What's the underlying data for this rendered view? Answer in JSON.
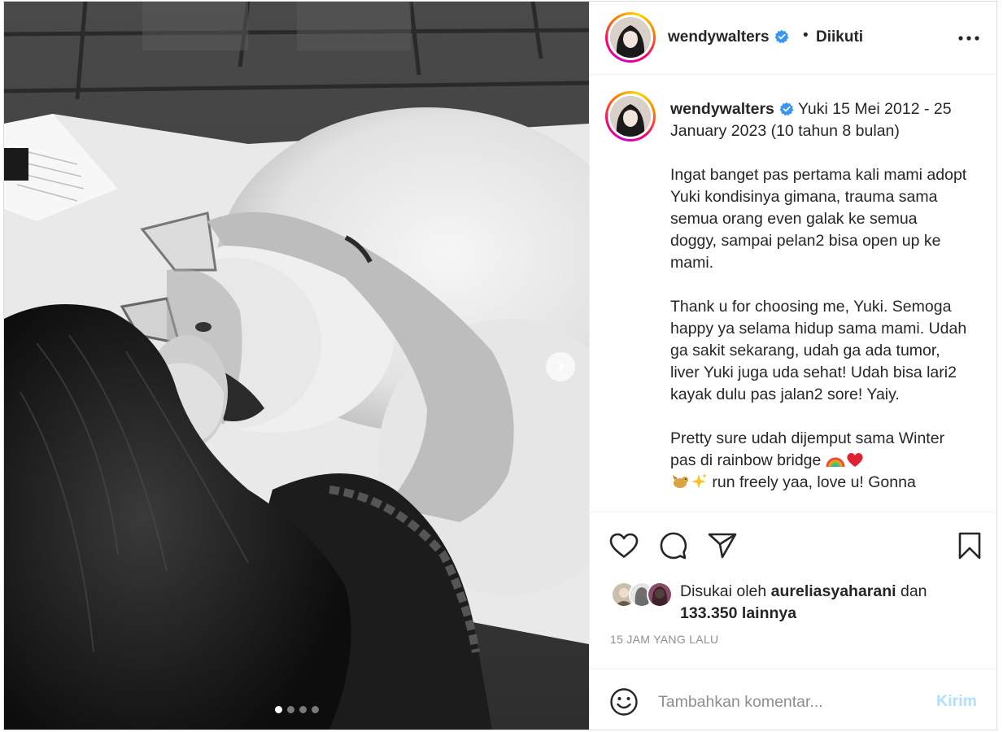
{
  "header": {
    "username": "wendywalters",
    "verified": true,
    "separator": "•",
    "follow_status": "Diikuti",
    "more_icon": "more-horizontal-icon"
  },
  "caption": {
    "username": "wendywalters",
    "text_part1": " Yuki 15 Mei 2012 - 25 January 2023 (10 tahun 8 bulan)\n\nIngat banget pas pertama kali mami adopt Yuki kondisinya gimana, trauma sama semua orang even galak ke semua doggy, sampai pelan2 bisa open up ke mami.\n\nThank u for choosing me, Yuki. Semoga happy ya selama hidup sama mami. Udah ga sakit sekarang, udah ga ada tumor, liver Yuki juga uda sehat! Udah bisa lari2 kayak dulu pas jalan2 sore! Yaiy.\n\nPretty sure udah dijemput sama Winter pas di rainbow bridge ",
    "text_part2": " run freely yaa, love u! Gonna",
    "emojis": [
      "rainbow-emoji",
      "red-heart-emoji",
      "dog-emoji",
      "sparkles-emoji"
    ]
  },
  "actions": {
    "like_icon": "heart-icon",
    "comment_icon": "comment-icon",
    "share_icon": "send-icon",
    "save_icon": "bookmark-icon"
  },
  "likes": {
    "prefix": "Disukai oleh ",
    "liker": "aureliasyaharani",
    "connector": " dan ",
    "others": "133.350 lainnya"
  },
  "timestamp": "15 JAM YANG LALU",
  "comment": {
    "placeholder": "Tambahkan komentar...",
    "post_label": "Kirim",
    "emoji_icon": "smiley-icon"
  },
  "media": {
    "carousel_count": 4,
    "carousel_active": 1,
    "next_icon": "chevron-right-icon"
  },
  "colors": {
    "verified_blue": "#3897f0",
    "post_button_disabled": "#b2dffc",
    "meta_gray": "#8e8e8e"
  }
}
